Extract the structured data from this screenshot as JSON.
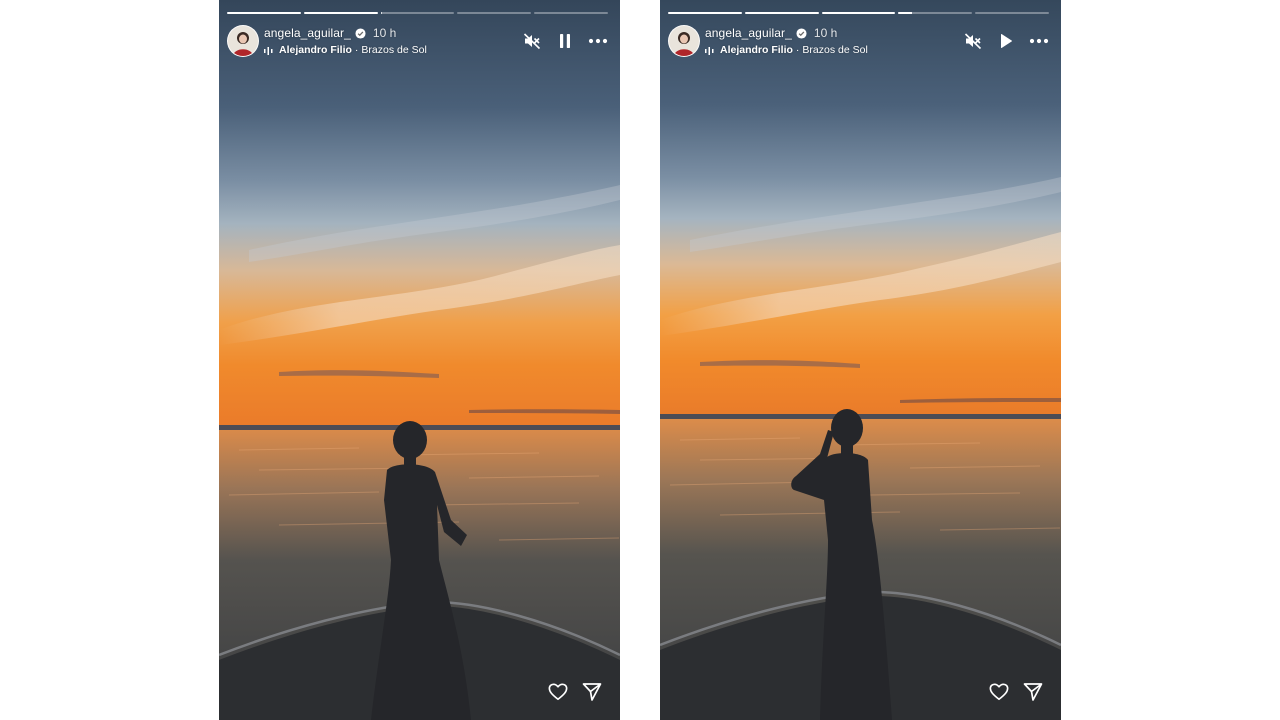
{
  "stories": [
    {
      "user": {
        "username": "angela_aguilar_",
        "verified": true,
        "time": "10 h"
      },
      "music": {
        "artist": "Alejandro Filio",
        "separator": "·",
        "song": "Brazos de Sol"
      },
      "progress": [
        1,
        1,
        0.02,
        0,
        0
      ],
      "playback": "playing",
      "controls": [
        "mute-icon",
        "pause-icon",
        "more-icon"
      ],
      "actions": [
        "heart-icon",
        "send-icon"
      ]
    },
    {
      "user": {
        "username": "angela_aguilar_",
        "verified": true,
        "time": "10 h"
      },
      "music": {
        "artist": "Alejandro Filio",
        "separator": "·",
        "song": "Brazos de Sol"
      },
      "progress": [
        1,
        1,
        1,
        0.18,
        0
      ],
      "playback": "paused",
      "controls": [
        "mute-icon",
        "play-icon",
        "more-icon"
      ],
      "actions": [
        "heart-icon",
        "send-icon"
      ]
    }
  ],
  "colors": {
    "ui": "#ffffff",
    "sky_top": "#37495c",
    "horizon": "#f08a2c",
    "water": "#4e4a45"
  }
}
